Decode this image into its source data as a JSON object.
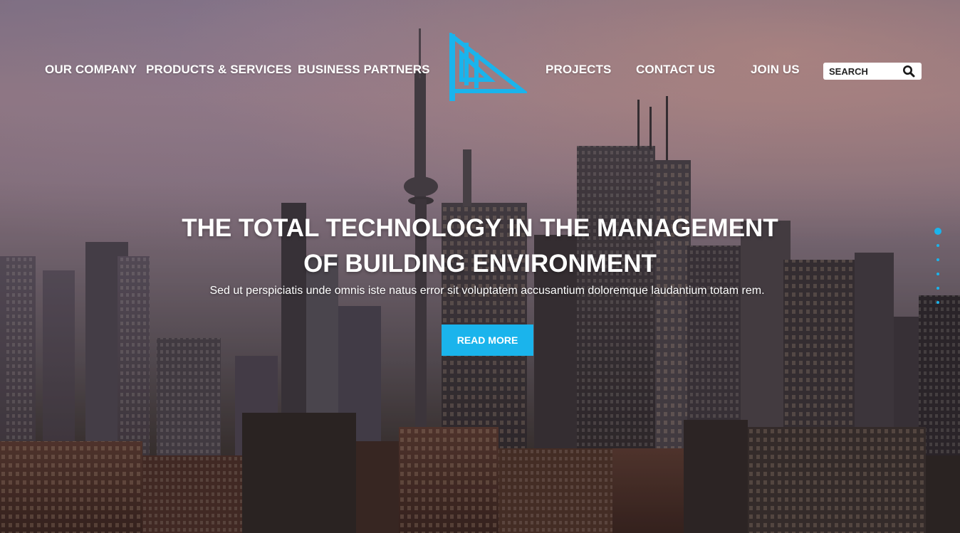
{
  "nav": {
    "left_items": [
      {
        "label": "OUR COMPANY"
      },
      {
        "label": "PRODUCTS & SERVICES"
      },
      {
        "label": "BUSINESS PARTNERS"
      }
    ],
    "right_items": [
      {
        "label": "PROJECTS"
      },
      {
        "label": "CONTACT US"
      },
      {
        "label": "JOIN US"
      }
    ],
    "logo_icon": "triangle-logo-icon",
    "search": {
      "placeholder": "SEARCH",
      "icon": "search-icon"
    }
  },
  "hero": {
    "headline_line1": "THE TOTAL TECHNOLOGY IN THE MANAGEMENT",
    "headline_line2": "OF BUILDING ENVIRONMENT",
    "subtext": "Sed ut perspiciatis unde omnis iste natus error sit voluptatem accusantium doloremque laudantium totam rem.",
    "cta_label": "READ MORE",
    "slides": {
      "count": 6,
      "active_index": 0
    }
  },
  "colors": {
    "accent": "#1ab4ec",
    "text": "#ffffff",
    "search_bg": "#ffffff"
  }
}
